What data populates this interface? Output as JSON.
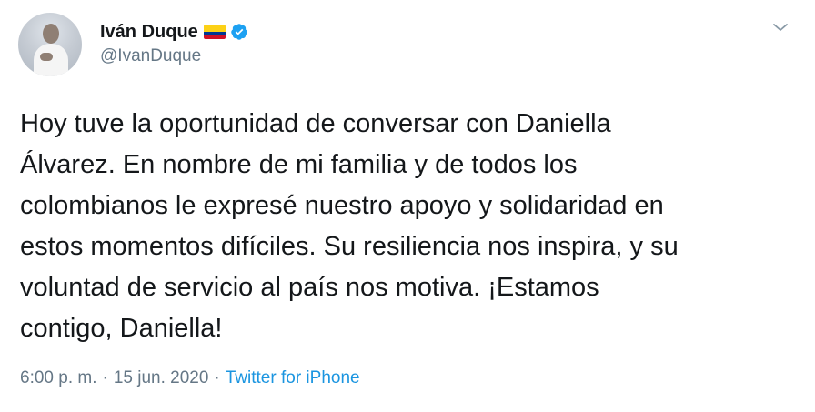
{
  "author": {
    "display_name": "Iván Duque",
    "handle": "@IvanDuque",
    "flag_icon": "colombia-flag-icon",
    "verified_icon": "verified-badge-icon",
    "avatar": "profile-avatar"
  },
  "tweet": {
    "text": "Hoy tuve la oportunidad de conversar con Daniella\nÁlvarez. En nombre de mi familia y de todos los\ncolombianos le expresé nuestro apoyo y solidaridad en\nestos momentos difíciles. Su resiliencia nos inspira, y su\nvoluntad de servicio al país nos motiva. ¡Estamos\ncontigo, Daniella!",
    "time": "6:00 p. m.",
    "date": "15 jun. 2020",
    "separator": "·",
    "source": "Twitter for iPhone"
  },
  "controls": {
    "more_icon": "chevron-down-icon"
  },
  "colors": {
    "accent": "#1b95e0",
    "verified": "#1da1f2",
    "muted": "#657786",
    "text": "#14171a"
  }
}
